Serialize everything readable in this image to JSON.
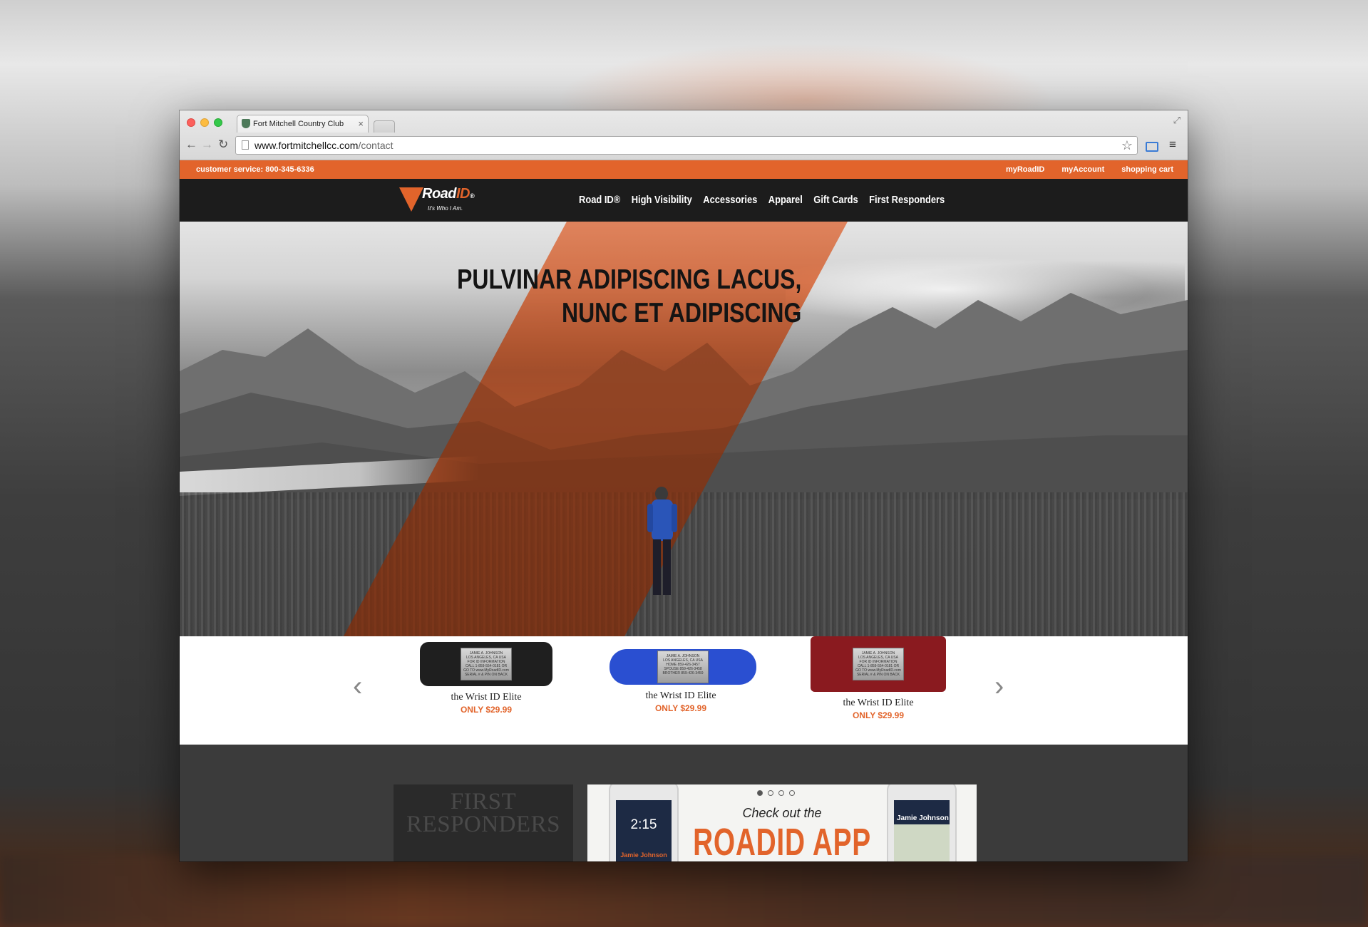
{
  "browser": {
    "tab_title": "Fort Mitchell Country Club",
    "tab_close": "×",
    "url_host": "www.fortmitchellcc.com",
    "url_path": "/contact"
  },
  "util_bar": {
    "customer_service": "customer service:  800-345-6336",
    "links": [
      "myRoadID",
      "myAccount",
      "shopping cart"
    ]
  },
  "brand": {
    "logo_road": "Road",
    "logo_id": "ID",
    "logo_reg": "®",
    "tagline": "It's Who I Am."
  },
  "nav": {
    "items": [
      "Road ID®",
      "High Visibility",
      "Accessories",
      "Apparel",
      "Gift Cards",
      "First Responders"
    ]
  },
  "hero": {
    "line1": "PULVINAR ADIPISCING LACUS,",
    "line2": "NUNC ET ADIPISCING"
  },
  "carousel": {
    "prev": "‹",
    "next": "›",
    "products": [
      {
        "name": "the Wrist ID Elite",
        "price": "ONLY $29.99",
        "plate": "JAMIE A. JOHNSON\nLOS ANGELES, CA USA\nFOR ID INFORMATION\nCALL 1-859-554-0181 OR\nGO TO www.MyRoadID.com\nSERIAL # & PIN ON BACK"
      },
      {
        "name": "the Wrist ID Elite",
        "price": "ONLY $29.99",
        "plate": "JAMIE A. JOHNSON\nLOS ANGELES, CA USA\nHOME 859-426-3457\nSPOUSE 859-426-3458\nBROTHER 859-426-3459"
      },
      {
        "name": "the Wrist ID Elite",
        "price": "ONLY $29.99",
        "plate": "JAMIE A. JOHNSON\nLOS ANGELES, CA USA\nFOR ID INFORMATION\nCALL 1-859-554-0181 OR\nGO TO www.MyRoadID.com\nSERIAL # & PIN ON BACK"
      }
    ]
  },
  "promos": {
    "first_responders": "FIRST RESPONDERS",
    "app_check_out": "Check out the",
    "app_title": "ROADID APP",
    "phone_time": "2:15",
    "phone_owner": "Jamie Johnson"
  },
  "colors": {
    "accent": "#e2642b",
    "nav_bg": "#1c1c1c",
    "lower_bg": "#3b3b3b"
  }
}
